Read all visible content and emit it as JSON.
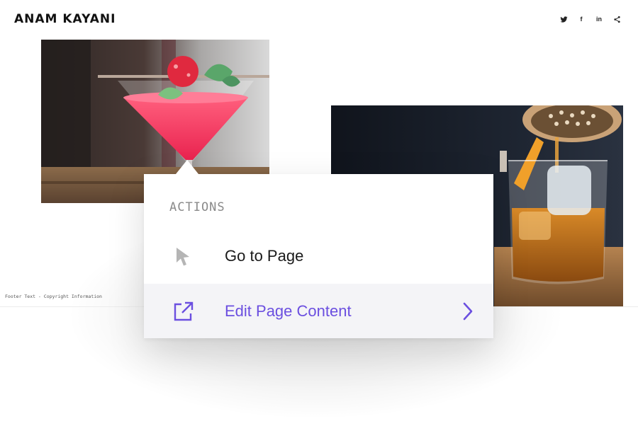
{
  "site": {
    "brand": "ANAM KAYANI"
  },
  "social": [
    {
      "name": "twitter",
      "icon": "twitter-icon"
    },
    {
      "name": "facebook",
      "icon": "facebook-icon",
      "glyph": "f"
    },
    {
      "name": "linkedin",
      "icon": "linkedin-icon",
      "glyph": "in"
    },
    {
      "name": "share",
      "icon": "share-icon"
    }
  ],
  "photos": [
    {
      "subject": "pink cocktail with strawberry and mint garnish"
    },
    {
      "subject": "amber drink poured over ice with orange peel"
    }
  ],
  "footer": {
    "text": "Footer Text - Copyright Information"
  },
  "actions": {
    "title": "ACTIONS",
    "items": [
      {
        "label": "Go to Page",
        "icon": "cursor-arrow-icon"
      },
      {
        "label": "Edit Page Content",
        "icon": "external-link-icon",
        "trailing_icon": "chevron-right-icon",
        "highlighted": true
      }
    ]
  },
  "colors": {
    "accent": "#6b4fe0",
    "muted": "#8a8a8a",
    "highlight_bg": "#f4f4f7"
  }
}
